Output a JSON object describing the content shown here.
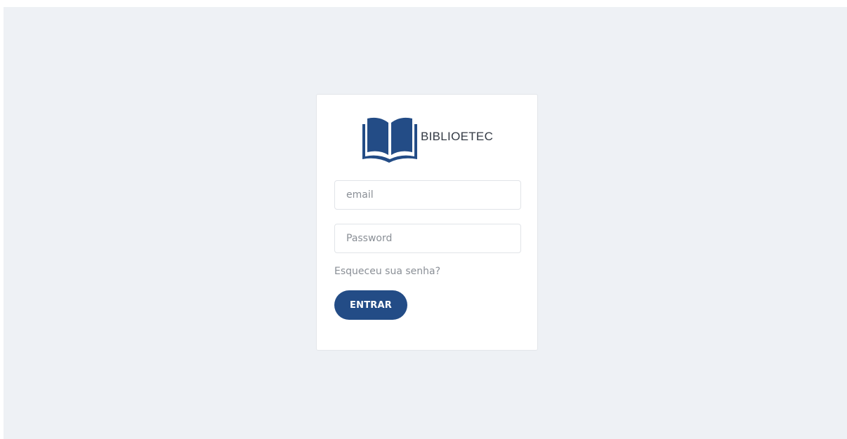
{
  "brand": {
    "name": "BIBLIOETEC",
    "logo_icon": "open-book-icon",
    "color": "#234c86"
  },
  "form": {
    "email_placeholder": "email",
    "password_placeholder": "Password",
    "forgot_label": "Esqueceu sua senha?",
    "submit_label": "ENTRAR"
  },
  "colors": {
    "background": "#eef1f5",
    "card": "#ffffff",
    "accent": "#234c86"
  }
}
